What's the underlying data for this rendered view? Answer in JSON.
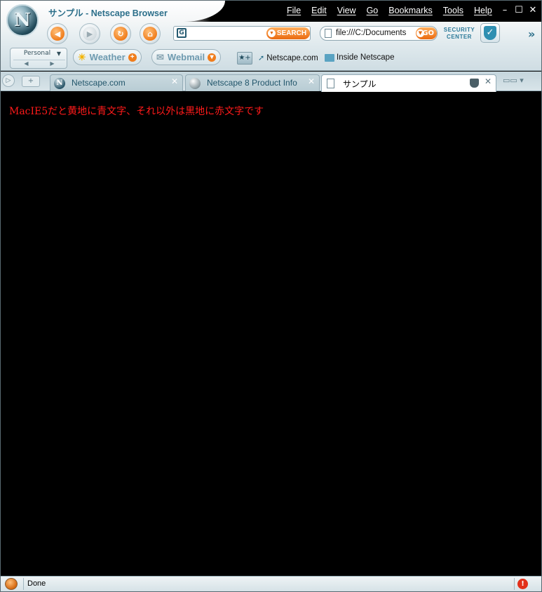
{
  "window": {
    "title": "サンプル - Netscape Browser",
    "logo_letter": "N"
  },
  "menu": [
    "File",
    "Edit",
    "View",
    "Go",
    "Bookmarks",
    "Tools",
    "Help"
  ],
  "window_controls": {
    "minimize": "–",
    "maximize": "☐",
    "close": "✕"
  },
  "nav": {
    "search_placeholder": "",
    "search_button": "SEARCH",
    "url_value": "file:///C:/Documents",
    "go_button": "GO",
    "security_label": "SECURITY CENTER"
  },
  "personal_bar": {
    "selector_label": "Personal",
    "weather_label": "Weather",
    "webmail_label": "Webmail",
    "bookmarks": [
      "Netscape.com",
      "Inside Netscape"
    ]
  },
  "tabs": [
    {
      "label": "Netscape.com",
      "icon": "netscape-icon",
      "active": false
    },
    {
      "label": "Netscape 8 Product Info",
      "icon": "globe-icon",
      "active": false
    },
    {
      "label": "サンプル",
      "icon": "page-icon",
      "active": true
    }
  ],
  "content": {
    "text": "MacIE5だと黄地に青文字、それ以外は黒地に赤文字です",
    "text_color": "#ff1a1a",
    "background_color": "#000000"
  },
  "status": {
    "text": "Done"
  },
  "colors": {
    "accent_orange": "#f07d1c",
    "brand_teal": "#2c6f8a"
  }
}
